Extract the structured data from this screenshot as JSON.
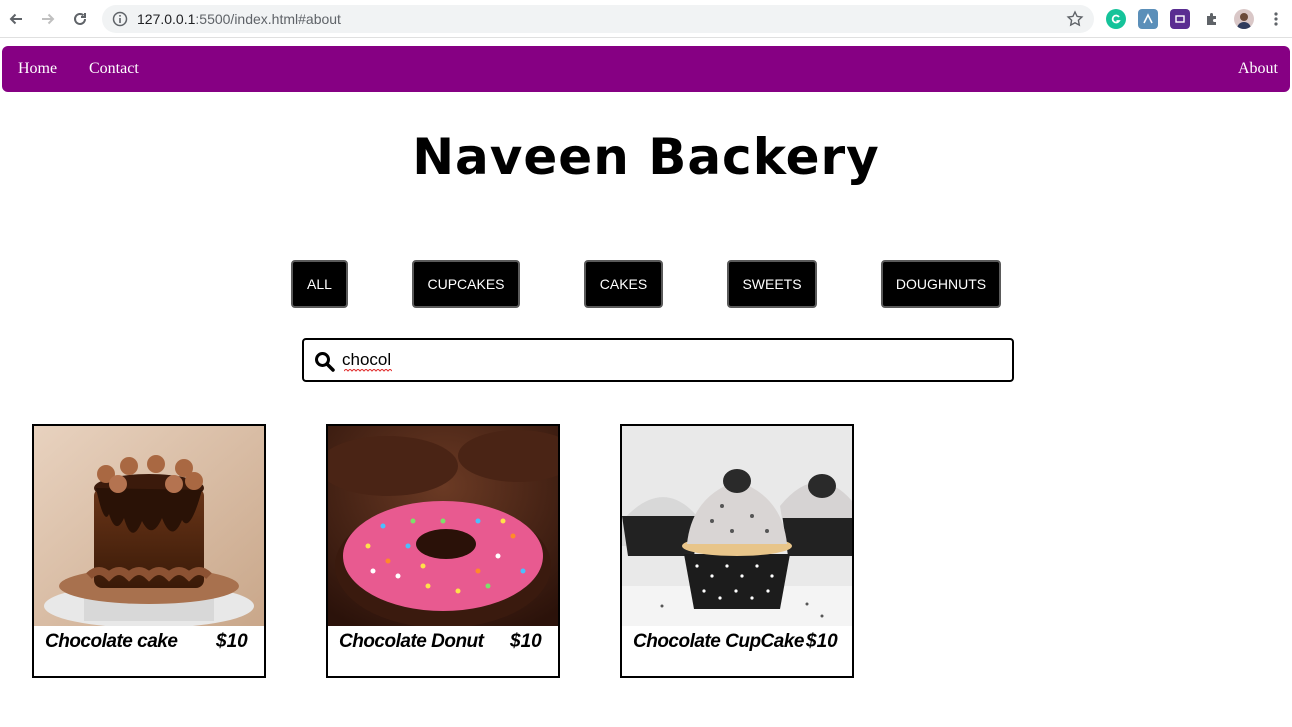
{
  "browser": {
    "url_host": "127.0.0.1",
    "url_rest": ":5500/index.html#about"
  },
  "nav": {
    "home": "Home",
    "contact": "Contact",
    "about": "About",
    "color": "#860083"
  },
  "page_title": "Naveen Backery",
  "filters": [
    "ALL",
    "CUPCAKES",
    "CAKES",
    "SWEETS",
    "DOUGHNUTS"
  ],
  "search": {
    "value": "chocol",
    "icon": "search-icon"
  },
  "products": [
    {
      "name": "Chocolate cake",
      "price": "$10",
      "image": "chocolate-cake-photo"
    },
    {
      "name": "Chocolate Donut",
      "price": "$10",
      "image": "chocolate-donut-photo"
    },
    {
      "name": "Chocolate CupCake",
      "price": "$10",
      "image": "chocolate-cupcake-photo"
    }
  ]
}
